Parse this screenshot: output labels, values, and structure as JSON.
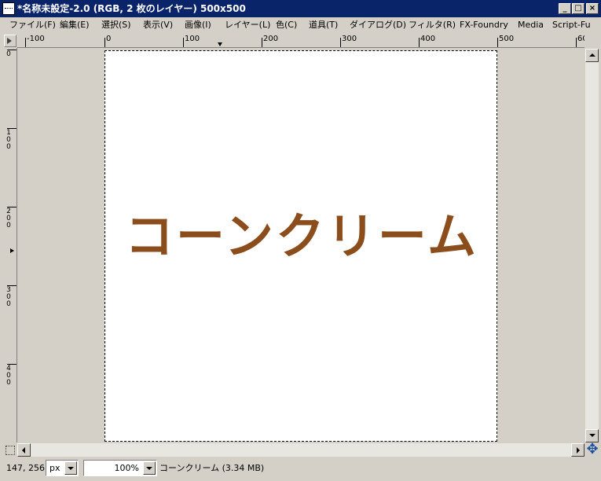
{
  "window": {
    "title": "*名称未設定-2.0 (RGB, 2 枚のレイヤー) 500x500",
    "minimize_glyph": "_",
    "maximize_glyph": "□",
    "close_glyph": "×"
  },
  "menubar": {
    "items": [
      "ファイル(F)",
      "編集(E)",
      "選択(S)",
      "表示(V)",
      "画像(I)",
      "レイヤー(L)",
      "色(C)",
      "道具(T)",
      "ダイアログ(D)",
      "フィルタ(R)",
      "FX-Foundry",
      "Media",
      "Script-Fu"
    ]
  },
  "rulers": {
    "horizontal_labels": [
      "-100",
      "0",
      "100",
      "200",
      "300",
      "400",
      "500",
      "60"
    ],
    "vertical_labels": [
      "0",
      "100",
      "200",
      "300",
      "400"
    ]
  },
  "canvas": {
    "text": "コーンクリーム",
    "text_color": "#8b4d1b",
    "background": "#ffffff"
  },
  "statusbar": {
    "pointer_coords": "147, 256",
    "unit": "px",
    "zoom": "100%",
    "message": "コーンクリーム (3.34 MB)"
  },
  "icons": {
    "navigate": "✥"
  }
}
